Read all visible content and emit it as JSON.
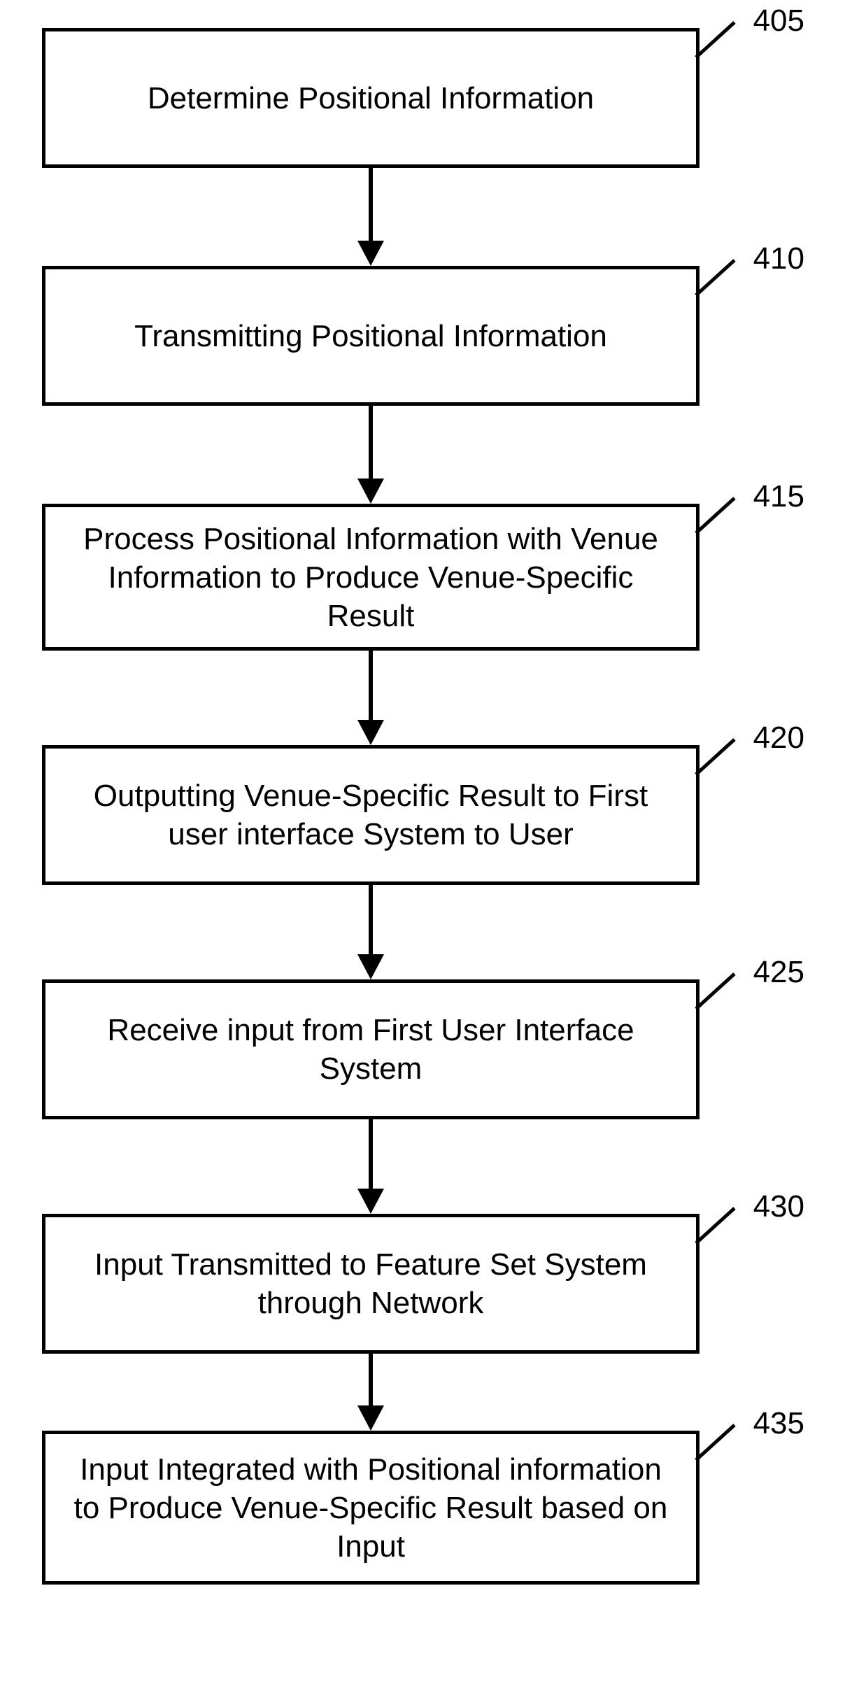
{
  "flowchart": {
    "steps": [
      {
        "ref": "405",
        "text": "Determine Positional Information"
      },
      {
        "ref": "410",
        "text": "Transmitting Positional Information"
      },
      {
        "ref": "415",
        "text": "Process Positional Information with Venue Information to Produce Venue-Specific Result"
      },
      {
        "ref": "420",
        "text": "Outputting Venue-Specific Result to First user interface System to User"
      },
      {
        "ref": "425",
        "text": "Receive input from First User Interface System"
      },
      {
        "ref": "430",
        "text": "Input Transmitted to Feature Set System through Network"
      },
      {
        "ref": "435",
        "text": "Input Integrated with Positional information to Produce Venue-Specific Result based on Input"
      }
    ]
  }
}
